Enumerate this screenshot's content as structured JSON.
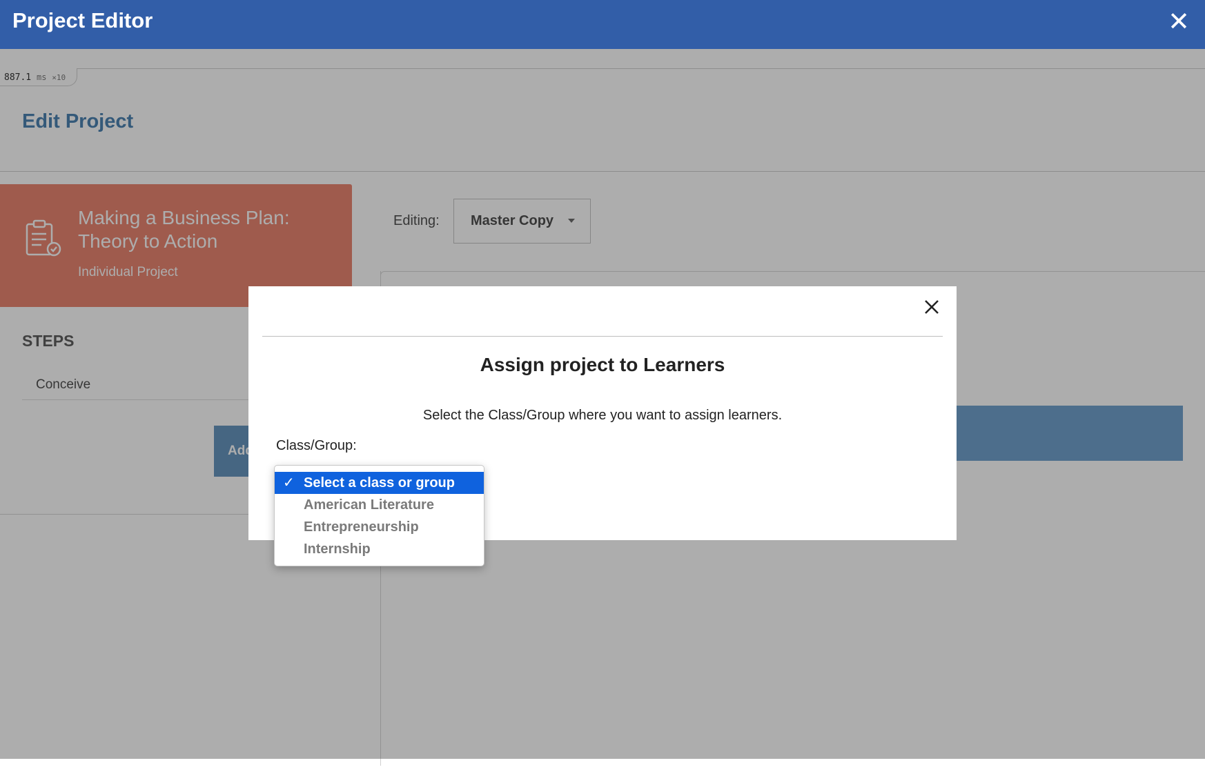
{
  "topbar": {
    "title": "Project Editor",
    "close": "✕"
  },
  "perf": {
    "value": "887.1",
    "unit": "ms",
    "multiplier": "×10"
  },
  "page": {
    "title": "Edit Project"
  },
  "project": {
    "title_line1": "Making a Business Plan:",
    "title_line2": "Theory to Action",
    "type": "Individual Project",
    "icon": "clipboard-check-icon"
  },
  "steps": {
    "title": "STEPS",
    "items": [
      "Conceive"
    ],
    "add_button": "Add"
  },
  "editing": {
    "label": "Editing:",
    "selected": "Master Copy"
  },
  "modal": {
    "title": "Assign project to Learners",
    "description": "Select the Class/Group where you want to assign learners.",
    "field_label": "Class/Group:"
  },
  "dropdown": {
    "selected_index": 0,
    "options": [
      "Select a class or group",
      "American Literature",
      "Entrepreneurship",
      "Internship"
    ],
    "check": "✓"
  },
  "colors": {
    "brand_blue": "#325ea8",
    "card_orange": "#e7735a",
    "title_blue": "#2f6fa6",
    "selected_blue": "#0f62de"
  }
}
